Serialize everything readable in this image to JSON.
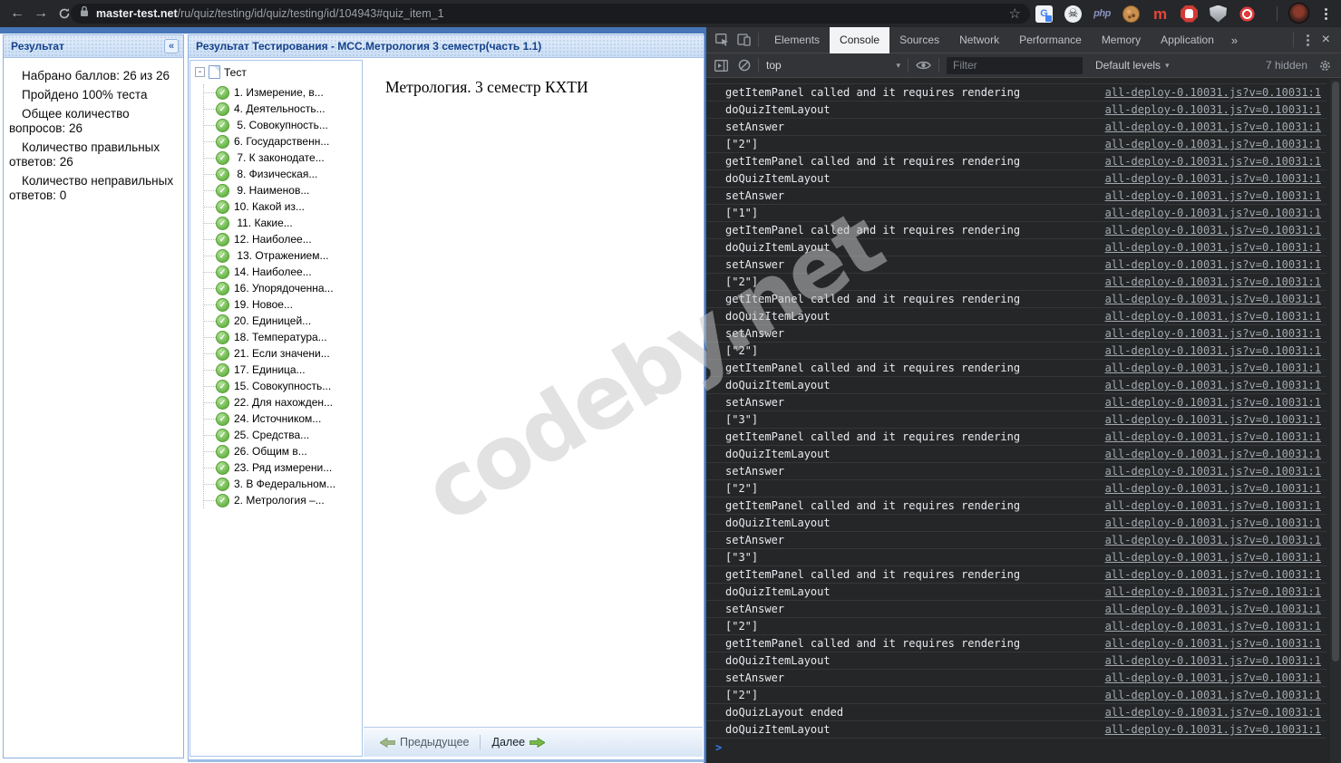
{
  "browser": {
    "url": {
      "domain": "master-test.net",
      "path": "/ru/quiz/testing/id/quiz/testing/id/104943#quiz_item_1"
    },
    "extensions": [
      {
        "name": "translate",
        "glyph": "G"
      },
      {
        "name": "skull",
        "glyph": "☠"
      },
      {
        "name": "php",
        "glyph": "php"
      },
      {
        "name": "cookie",
        "glyph": ""
      },
      {
        "name": "monkey",
        "glyph": "m"
      },
      {
        "name": "stop-hand",
        "glyph": ""
      },
      {
        "name": "shield",
        "glyph": ""
      },
      {
        "name": "ad-eye",
        "glyph": ""
      }
    ]
  },
  "results_panel": {
    "title": "Результат",
    "collapse_glyph": "«",
    "stats": [
      "Набрано баллов: 26 из 26",
      "Пройдено 100% теста",
      "Общее количество вопросов: 26",
      "Количество правильных ответов: 26",
      "Количество неправильных ответов: 0"
    ]
  },
  "quiz_panel": {
    "title": "Результат Тестирования - МСС.Метрология 3 семестр(часть 1.1)",
    "tree_root": "Тест",
    "expander_glyph": "-",
    "tree_items": [
      "1. Измерение, в...",
      "4. Деятельность...",
      " 5. Совокупность...",
      "6. Государственн...",
      " 7. К законодате...",
      " 8. Физическая...",
      " 9. Наименов...",
      "10. Какой из...",
      " 11. Какие...",
      "12. Наиболее...",
      " 13. Отражением...",
      "14. Наиболее...",
      "16. Упорядоченна...",
      "19. Новое...",
      "20. Единицей...",
      "18. Температура...",
      "21. Если значени...",
      "17. Единица...",
      "15. Совокупность...",
      "22. Для нахожден...",
      "24. Источником...",
      "25. Средства...",
      "26. Общим в...",
      "23. Ряд измерени...",
      "3. В Федеральном...",
      "2. Метрология –..."
    ],
    "check_glyph": "✓",
    "content_title": "Метрология. 3 семестр КХТИ",
    "footer": {
      "prev_label": "Предыдущее",
      "next_label": "Далее"
    }
  },
  "devtools": {
    "tabs": [
      {
        "label": "Elements"
      },
      {
        "label": "Console"
      },
      {
        "label": "Sources"
      },
      {
        "label": "Network"
      },
      {
        "label": "Performance"
      },
      {
        "label": "Memory"
      },
      {
        "label": "Application"
      }
    ],
    "active_tab": "Console",
    "more_tabs_glyph": "»",
    "close_glyph": "×",
    "toolbar": {
      "context": "top",
      "caret_glyph": "▾",
      "filter_placeholder": "Filter",
      "levels_label": "Default levels",
      "hidden_label": "7 hidden"
    },
    "console": {
      "prompt_glyph": ">",
      "entries": [
        {
          "msg": "getItemPanel called and it requires rendering",
          "src": "all-deploy-0.10031.js?v=0.10031:1"
        },
        {
          "msg": "doQuizItemLayout",
          "src": "all-deploy-0.10031.js?v=0.10031:1"
        },
        {
          "msg": "setAnswer",
          "src": "all-deploy-0.10031.js?v=0.10031:1"
        },
        {
          "msg": "[\"2\"]",
          "src": "all-deploy-0.10031.js?v=0.10031:1"
        },
        {
          "msg": "getItemPanel called and it requires rendering",
          "src": "all-deploy-0.10031.js?v=0.10031:1"
        },
        {
          "msg": "doQuizItemLayout",
          "src": "all-deploy-0.10031.js?v=0.10031:1"
        },
        {
          "msg": "setAnswer",
          "src": "all-deploy-0.10031.js?v=0.10031:1"
        },
        {
          "msg": "[\"1\"]",
          "src": "all-deploy-0.10031.js?v=0.10031:1"
        },
        {
          "msg": "getItemPanel called and it requires rendering",
          "src": "all-deploy-0.10031.js?v=0.10031:1"
        },
        {
          "msg": "doQuizItemLayout",
          "src": "all-deploy-0.10031.js?v=0.10031:1"
        },
        {
          "msg": "setAnswer",
          "src": "all-deploy-0.10031.js?v=0.10031:1"
        },
        {
          "msg": "[\"2\"]",
          "src": "all-deploy-0.10031.js?v=0.10031:1"
        },
        {
          "msg": "getItemPanel called and it requires rendering",
          "src": "all-deploy-0.10031.js?v=0.10031:1"
        },
        {
          "msg": "doQuizItemLayout",
          "src": "all-deploy-0.10031.js?v=0.10031:1"
        },
        {
          "msg": "setAnswer",
          "src": "all-deploy-0.10031.js?v=0.10031:1"
        },
        {
          "msg": "[\"2\"]",
          "src": "all-deploy-0.10031.js?v=0.10031:1"
        },
        {
          "msg": "getItemPanel called and it requires rendering",
          "src": "all-deploy-0.10031.js?v=0.10031:1"
        },
        {
          "msg": "doQuizItemLayout",
          "src": "all-deploy-0.10031.js?v=0.10031:1"
        },
        {
          "msg": "setAnswer",
          "src": "all-deploy-0.10031.js?v=0.10031:1"
        },
        {
          "msg": "[\"3\"]",
          "src": "all-deploy-0.10031.js?v=0.10031:1"
        },
        {
          "msg": "getItemPanel called and it requires rendering",
          "src": "all-deploy-0.10031.js?v=0.10031:1"
        },
        {
          "msg": "doQuizItemLayout",
          "src": "all-deploy-0.10031.js?v=0.10031:1"
        },
        {
          "msg": "setAnswer",
          "src": "all-deploy-0.10031.js?v=0.10031:1"
        },
        {
          "msg": "[\"2\"]",
          "src": "all-deploy-0.10031.js?v=0.10031:1"
        },
        {
          "msg": "getItemPanel called and it requires rendering",
          "src": "all-deploy-0.10031.js?v=0.10031:1"
        },
        {
          "msg": "doQuizItemLayout",
          "src": "all-deploy-0.10031.js?v=0.10031:1"
        },
        {
          "msg": "setAnswer",
          "src": "all-deploy-0.10031.js?v=0.10031:1"
        },
        {
          "msg": "[\"3\"]",
          "src": "all-deploy-0.10031.js?v=0.10031:1"
        },
        {
          "msg": "getItemPanel called and it requires rendering",
          "src": "all-deploy-0.10031.js?v=0.10031:1"
        },
        {
          "msg": "doQuizItemLayout",
          "src": "all-deploy-0.10031.js?v=0.10031:1"
        },
        {
          "msg": "setAnswer",
          "src": "all-deploy-0.10031.js?v=0.10031:1"
        },
        {
          "msg": "[\"2\"]",
          "src": "all-deploy-0.10031.js?v=0.10031:1"
        },
        {
          "msg": "getItemPanel called and it requires rendering",
          "src": "all-deploy-0.10031.js?v=0.10031:1"
        },
        {
          "msg": "doQuizItemLayout",
          "src": "all-deploy-0.10031.js?v=0.10031:1"
        },
        {
          "msg": "setAnswer",
          "src": "all-deploy-0.10031.js?v=0.10031:1"
        },
        {
          "msg": "[\"2\"]",
          "src": "all-deploy-0.10031.js?v=0.10031:1"
        },
        {
          "msg": "doQuizLayout ended",
          "src": "all-deploy-0.10031.js?v=0.10031:1"
        },
        {
          "msg": "doQuizItemLayout",
          "src": "all-deploy-0.10031.js?v=0.10031:1"
        }
      ]
    }
  },
  "watermark": "codeby.net",
  "colors": {
    "accent_blue": "#4676b8",
    "panel_border": "#8db2e3",
    "header_text": "#15428b",
    "console_bg": "#242628",
    "toolbar_bg": "#333438",
    "check_green": "#69b54a"
  }
}
